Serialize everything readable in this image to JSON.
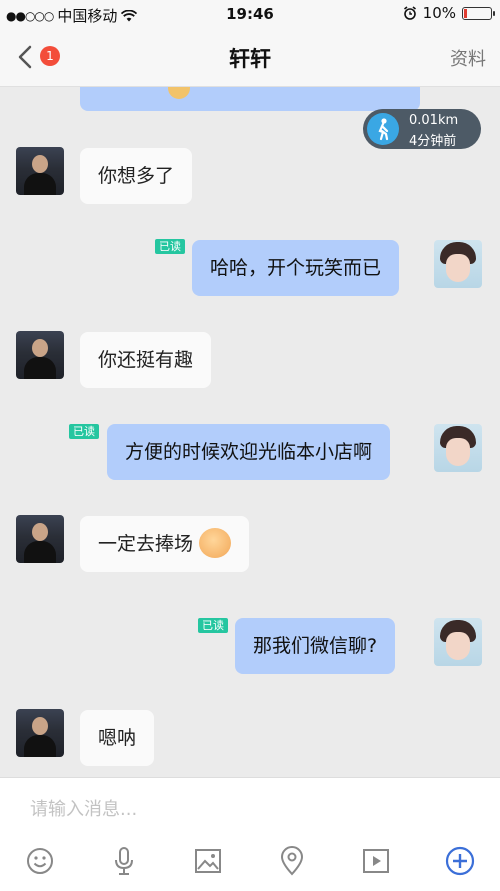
{
  "status": {
    "carrier": "中国移动",
    "time": "19:46",
    "battery": "10%",
    "battery_color": "#e03c31"
  },
  "nav": {
    "badge": "1",
    "title": "轩轩",
    "right": "资料"
  },
  "location_pill": {
    "distance": "0.01km",
    "time_ago": "4分钟前"
  },
  "read_label": "已读",
  "messages": [
    {
      "side": "in",
      "text": "你想多了"
    },
    {
      "side": "out",
      "text": "哈哈，开个玩笑而已",
      "read": true
    },
    {
      "side": "in",
      "text": "你还挺有趣"
    },
    {
      "side": "out",
      "text": "方便的时候欢迎光临本小店啊",
      "read": true
    },
    {
      "side": "in",
      "text": "一定去捧场",
      "emoji": "shy-face-emoji"
    },
    {
      "side": "out",
      "text": "那我们微信聊?",
      "read": true
    },
    {
      "side": "in",
      "text": "嗯呐"
    }
  ],
  "input": {
    "placeholder": "请输入消息..."
  },
  "toolbar_icons": [
    "emoji-icon",
    "microphone-icon",
    "image-icon",
    "location-icon",
    "video-icon",
    "plus-icon"
  ],
  "colors": {
    "outgoing_bubble": "#b2cdfb",
    "incoming_bubble": "#fafafa",
    "read_badge": "#25c6a0",
    "badge": "#f34d3a",
    "accent_plus": "#3b6fd8"
  }
}
